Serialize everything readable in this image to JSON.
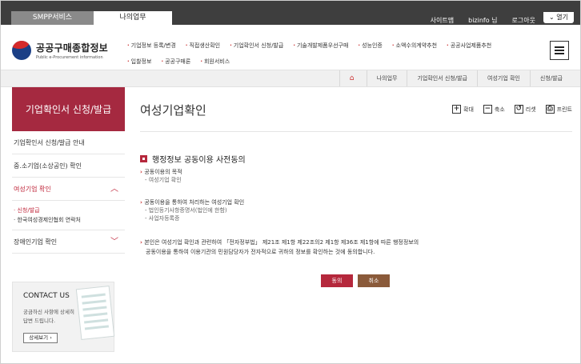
{
  "topbar": {
    "tabs": [
      "SMPP서비스",
      "나의업무"
    ],
    "links": [
      "사이트맵",
      "bizinfo 님",
      "로그아웃"
    ],
    "open_label": "열기"
  },
  "logo": {
    "title": "공공구매종합정보",
    "subtitle": "Public e-Procurement information"
  },
  "gnb": {
    "row1": [
      "기업정보 등록/변경",
      "직접생산확인",
      "기업확인서 신청/발급",
      "기술개발제품우선구매",
      "성능인증",
      "소액수의계약추천",
      "공공사업제품추천"
    ],
    "row2": [
      "입찰정보",
      "공공구매론",
      "회원서비스"
    ]
  },
  "breadcrumb": [
    "나의업무",
    "기업확인서 신청/발급",
    "여성기업 확인",
    "신청/발급"
  ],
  "sidebar": {
    "title": "기업확인서 신청/발급",
    "items": [
      "기업확인서 신청/발급 안내",
      "중.소기업(소상공인) 확인",
      "여성기업 확인",
      "장애인기업 확인"
    ],
    "subitems": [
      "신청/발급",
      "한국여성경제인협회 연락처"
    ]
  },
  "contact": {
    "title": "CONTACT US",
    "text1": "궁금하신 사항에 상세히",
    "text2": "답변 드립니다.",
    "detail": "상세보기"
  },
  "main": {
    "title": "여성기업확인",
    "tools": [
      "확대",
      "축소",
      "리셋",
      "프린트"
    ],
    "section_title": "행정정보 공동이용 사전동의",
    "purpose_heading": "공동이용의 목적",
    "purpose_items": [
      "여성기업 확인"
    ],
    "info_heading": "공동이용을 통하여 처리하는 여성기업 확인",
    "info_items": [
      "법인등기사항증명서(법인에 한함)",
      "사업자등록증"
    ],
    "consent_line1": "본인은 여성기업 확인과 관련하여 「전자정부법」 제21조 제1항 제22조의2 제1항 제36조 제1항에 따른 행정정보의",
    "consent_line2": "공동이용을 통하여 이용기관의 민원담당자가 전자적으로 귀하의 정보를 확인하는 것에 동의합니다.",
    "agree_label": "동의",
    "cancel_label": "취소"
  },
  "colors": {
    "accent": "#b5283c",
    "topbar": "#3e3e3e",
    "cancel": "#8a5a3a"
  }
}
